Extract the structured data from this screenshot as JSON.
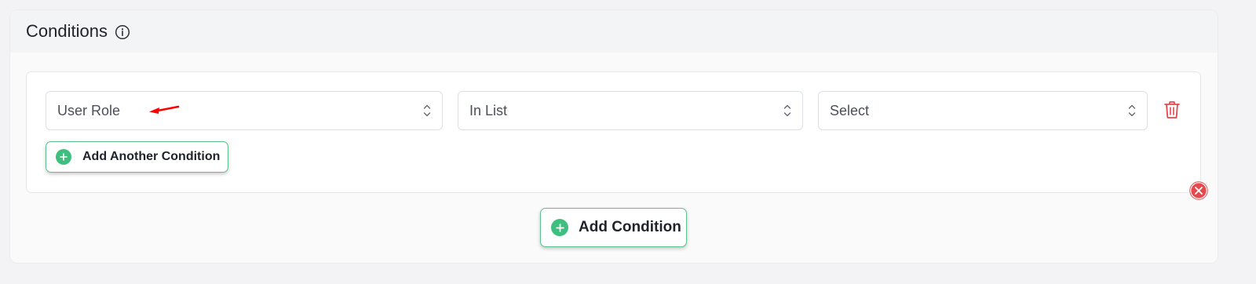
{
  "conditions_panel": {
    "title": "Conditions",
    "info_icon": "info-circle-icon"
  },
  "condition_group": {
    "rows": [
      {
        "field": {
          "value": "User Role"
        },
        "operator": {
          "value": "In List"
        },
        "value": {
          "value": "Select"
        },
        "delete_icon": "trash-icon"
      }
    ],
    "add_another_label": "Add Another Condition",
    "remove_group_icon": "close-circle-icon"
  },
  "add_condition_label": "Add Condition",
  "colors": {
    "accent_green": "#3fbf7f",
    "danger_red": "#e5484d",
    "annotation_arrow": "#ff0000"
  }
}
